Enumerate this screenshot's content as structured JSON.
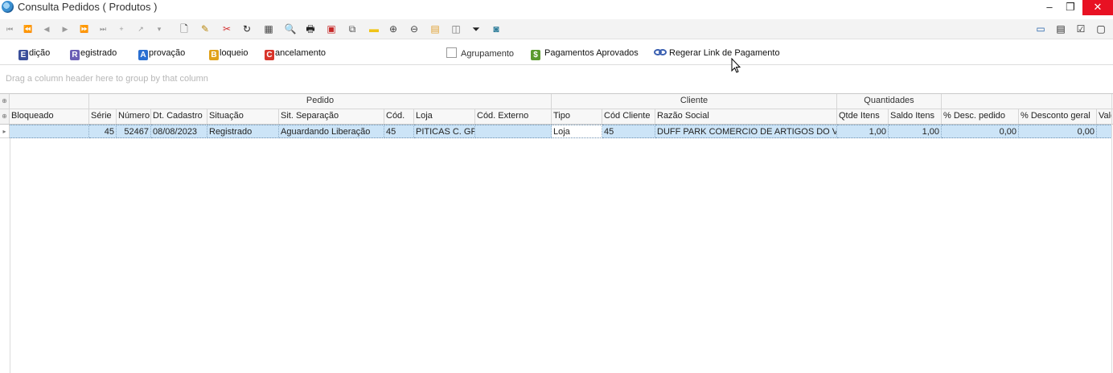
{
  "window": {
    "title": "Consulta Pedidos ( Produtos )",
    "minimize": "–",
    "restore": "❐",
    "close": "✕"
  },
  "toolbar1": {
    "nav": [
      "⏮",
      "⏪",
      "◀",
      "▶",
      "⏩",
      "⏭",
      "+",
      "↗",
      "▾"
    ],
    "tools": [
      "🗋",
      "✎",
      "✂",
      "↻",
      "▦",
      "🔍",
      "🖶",
      "▣",
      "⧉",
      "▬",
      "⊕",
      "⊖",
      "▤",
      "◫",
      "⏷",
      "◙"
    ],
    "right": [
      "▭",
      "▤",
      "☑",
      "▢"
    ]
  },
  "toolbar2": {
    "edicao": {
      "icon": "E",
      "label": "dição"
    },
    "registrado": {
      "icon": "R",
      "label": "egistrado"
    },
    "aprovacao": {
      "icon": "A",
      "label": "provação"
    },
    "bloqueio": {
      "icon": "B",
      "label": "loqueio"
    },
    "cancelamento": {
      "icon": "C",
      "label": "ancelamento"
    },
    "agrupamento": "Agrupamento",
    "pagamentos_aprovados": "Pagamentos Aprovados",
    "regerar_link": "Regerar Link de Pagamento",
    "pag_icon": "$"
  },
  "groupby_hint": "Drag a column header here to group by that column",
  "bands": [
    "Pedido",
    "Cliente",
    "Quantidades"
  ],
  "columns": [
    "Bloqueado",
    "Série",
    "Número",
    "Dt. Cadastro",
    "Situação",
    "Sit. Separação",
    "Cód.",
    "Loja",
    "Cód. Externo",
    "Tipo",
    "Cód Cliente",
    "Razão Social",
    "Qtde Itens",
    "Saldo Itens",
    "% Desc. pedido",
    "% Desconto geral",
    "Valo"
  ],
  "row": {
    "bloqueado": "",
    "serie": "45",
    "numero": "52467",
    "dt_cadastro": "08/08/2023",
    "situacao": "Registrado",
    "sit_separacao": "Aguardando Liberação",
    "cod": "45",
    "loja": "PITICAS C. GR",
    "cod_externo": "",
    "tipo": "Loja",
    "cod_cliente": "45",
    "razao_social": "DUFF PARK COMERCIO DE ARTIGOS DO VES",
    "qtde_itens": "1,00",
    "saldo_itens": "1,00",
    "desc_pedido": "0,00",
    "desconto_geral": "0,00",
    "valor": ""
  },
  "colors": {
    "selected_row": "#cce4f7",
    "close_button": "#e81123"
  }
}
